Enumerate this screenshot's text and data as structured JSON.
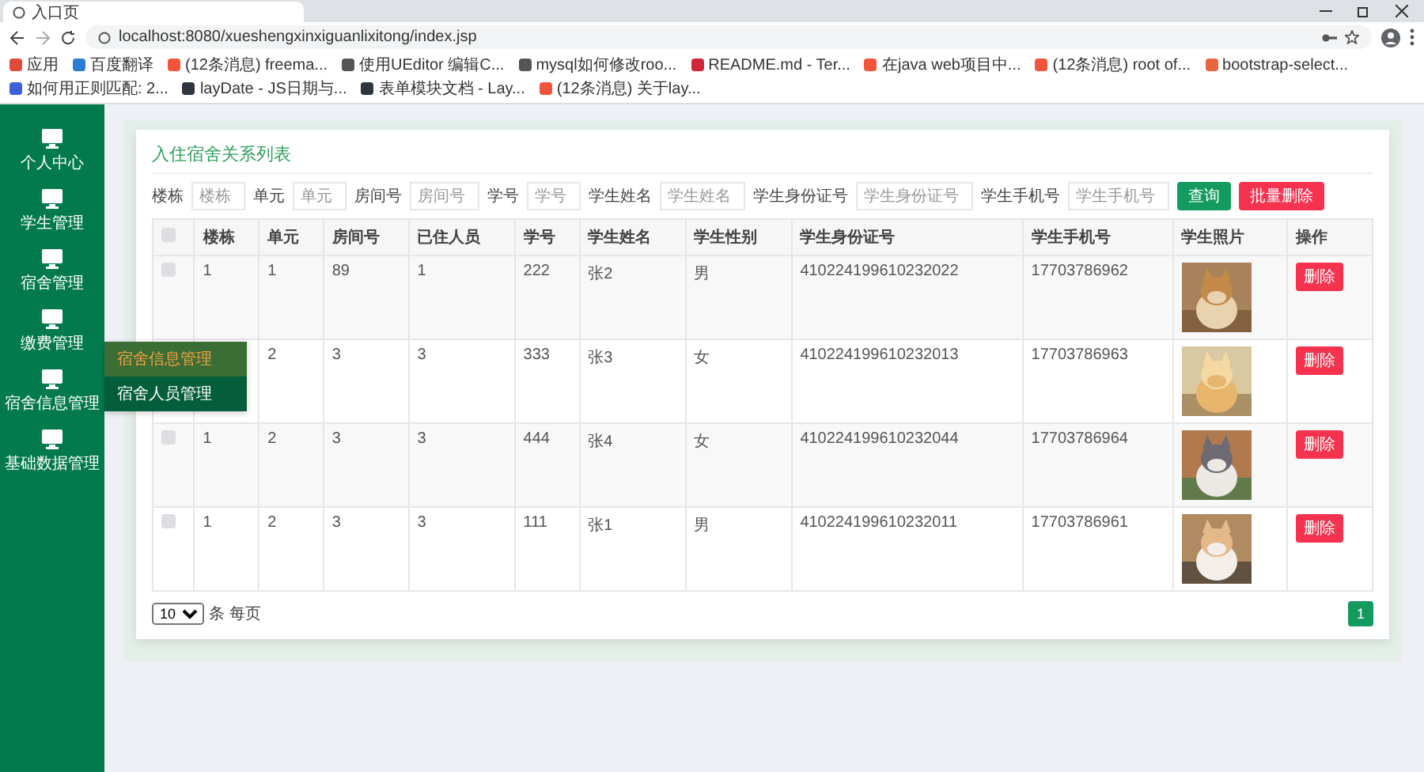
{
  "browser": {
    "tab": {
      "title": "入口页"
    },
    "url": "localhost:8080/xueshengxinxiguanlixitong/index.jsp",
    "bookmarks": [
      {
        "label": "应用",
        "color": "#e04a3a"
      },
      {
        "label": "百度翻译",
        "color": "#2b7cd3"
      },
      {
        "label": "(12条消息) freema...",
        "color": "#f2553b"
      },
      {
        "label": "使用UEditor 编辑C...",
        "color": "#555555"
      },
      {
        "label": "mysql如何修改roo...",
        "color": "#555555"
      },
      {
        "label": "README.md - Ter...",
        "color": "#d2263a"
      },
      {
        "label": "在java web项目中...",
        "color": "#f2553b"
      },
      {
        "label": "(12条消息) root of...",
        "color": "#f2553b"
      },
      {
        "label": "bootstrap-select...",
        "color": "#e8663d"
      },
      {
        "label": "如何用正则匹配: 2...",
        "color": "#3b63d8"
      },
      {
        "label": "layDate - JS日期与...",
        "color": "#2e3440"
      },
      {
        "label": "表单模块文档 - Lay...",
        "color": "#2e3440"
      },
      {
        "label": "(12条消息) 关于lay...",
        "color": "#f2553b"
      }
    ]
  },
  "sidebar": {
    "items": [
      {
        "label": "个人中心"
      },
      {
        "label": "学生管理"
      },
      {
        "label": "宿舍管理"
      },
      {
        "label": "缴费管理"
      },
      {
        "label": "宿舍信息管理",
        "children": [
          {
            "label": "宿舍信息管理",
            "selected": true
          },
          {
            "label": "宿舍人员管理",
            "selected": false
          }
        ]
      },
      {
        "label": "基础数据管理"
      }
    ]
  },
  "card": {
    "title": "入住宿舍关系列表",
    "filters": [
      {
        "label": "楼栋",
        "placeholder": "楼栋"
      },
      {
        "label": "单元",
        "placeholder": "单元"
      },
      {
        "label": "房间号",
        "placeholder": "房间号"
      },
      {
        "label": "学号",
        "placeholder": "学号"
      },
      {
        "label": "学生姓名",
        "placeholder": "学生姓名"
      },
      {
        "label": "学生身份证号",
        "placeholder": "学生身份证号"
      },
      {
        "label": "学生手机号",
        "placeholder": "学生手机号"
      }
    ],
    "buttons": [
      {
        "label": "查询",
        "kind": "primary"
      },
      {
        "label": "批量删除",
        "kind": "danger"
      }
    ],
    "table": {
      "select_all": {
        "checked": false
      },
      "columns": [
        "楼栋",
        "单元",
        "房间号",
        "已住人员",
        "学号",
        "学生姓名",
        "学生性别",
        "学生身份证号",
        "学生手机号",
        "学生照片",
        "操作"
      ],
      "rows": [
        {
          "checked": false,
          "cells": [
            "1",
            "1",
            "89",
            "1",
            "222",
            "张2",
            "男",
            "410224199610232022",
            "17703786962"
          ],
          "action": "删除"
        },
        {
          "cells": [
            null,
            "2",
            "3",
            "3",
            "333",
            "张3",
            "女",
            "410224199610232013",
            "17703786963"
          ],
          "action": "删除"
        },
        {
          "checked": false,
          "cells": [
            "1",
            "2",
            "3",
            "3",
            "444",
            "张4",
            "女",
            "410224199610232044",
            "17703786964"
          ],
          "action": "删除"
        },
        {
          "checked": false,
          "cells": [
            "1",
            "2",
            "3",
            "3",
            "111",
            "张1",
            "男",
            "410224199610232011",
            "17703786961"
          ],
          "action": "删除"
        }
      ]
    },
    "pagination": {
      "page_size": "10",
      "page_size_label": "条 每页",
      "pages": [
        {
          "label": "1",
          "selected": true
        }
      ]
    }
  }
}
